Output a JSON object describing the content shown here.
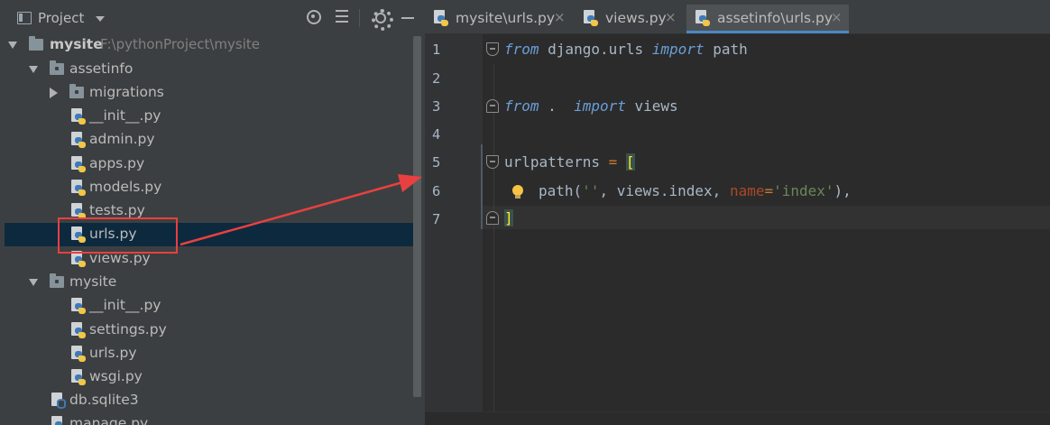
{
  "project_panel": {
    "title": "Project",
    "tree": [
      {
        "label": "mysite",
        "hint": "F:\\pythonProject\\mysite",
        "type": "folder",
        "expanded": true
      },
      {
        "label": "assetinfo",
        "type": "package",
        "expanded": true
      },
      {
        "label": "migrations",
        "type": "package",
        "expanded": false
      },
      {
        "label": "__init__.py",
        "type": "python"
      },
      {
        "label": "admin.py",
        "type": "python"
      },
      {
        "label": "apps.py",
        "type": "python"
      },
      {
        "label": "models.py",
        "type": "python"
      },
      {
        "label": "tests.py",
        "type": "python"
      },
      {
        "label": "urls.py",
        "type": "python",
        "selected": true
      },
      {
        "label": "views.py",
        "type": "python"
      },
      {
        "label": "mysite",
        "type": "package",
        "expanded": true
      },
      {
        "label": "__init__.py",
        "type": "python"
      },
      {
        "label": "settings.py",
        "type": "python"
      },
      {
        "label": "urls.py",
        "type": "python"
      },
      {
        "label": "wsgi.py",
        "type": "python"
      },
      {
        "label": "db.sqlite3",
        "type": "database"
      },
      {
        "label": "manage.py",
        "type": "python"
      }
    ]
  },
  "editor": {
    "tabs": [
      {
        "label": "mysite\\urls.py",
        "close": "×",
        "active": false
      },
      {
        "label": "views.py",
        "close": "×",
        "active": false
      },
      {
        "label": "assetinfo\\urls.py",
        "close": "×",
        "active": true
      }
    ],
    "line_numbers": [
      "1",
      "2",
      "3",
      "4",
      "5",
      "6",
      "7"
    ],
    "code": {
      "l1": {
        "kw1": "from",
        "mod": " django.urls ",
        "kw2": "import",
        "name": " path"
      },
      "l3": {
        "kw1": "from",
        "mod": " . ",
        "kw2": " import",
        "name": " views"
      },
      "l5": {
        "name": "urlpatterns ",
        "op": "=",
        "sp": " ",
        "bracket": "["
      },
      "l6": {
        "call": "path(",
        "s1": "''",
        "comma1": ", views.index, ",
        "kw": "name",
        "eq": "=",
        "s2": "'index'",
        "end": "),"
      },
      "l7": {
        "bracket": "]"
      }
    }
  },
  "colors": {
    "keyword": "#6a9fd8",
    "string": "#6a8759",
    "param": "#aa4926",
    "operator": "#cc7832",
    "selection": "#0d293e",
    "annotation": "#e84040"
  }
}
